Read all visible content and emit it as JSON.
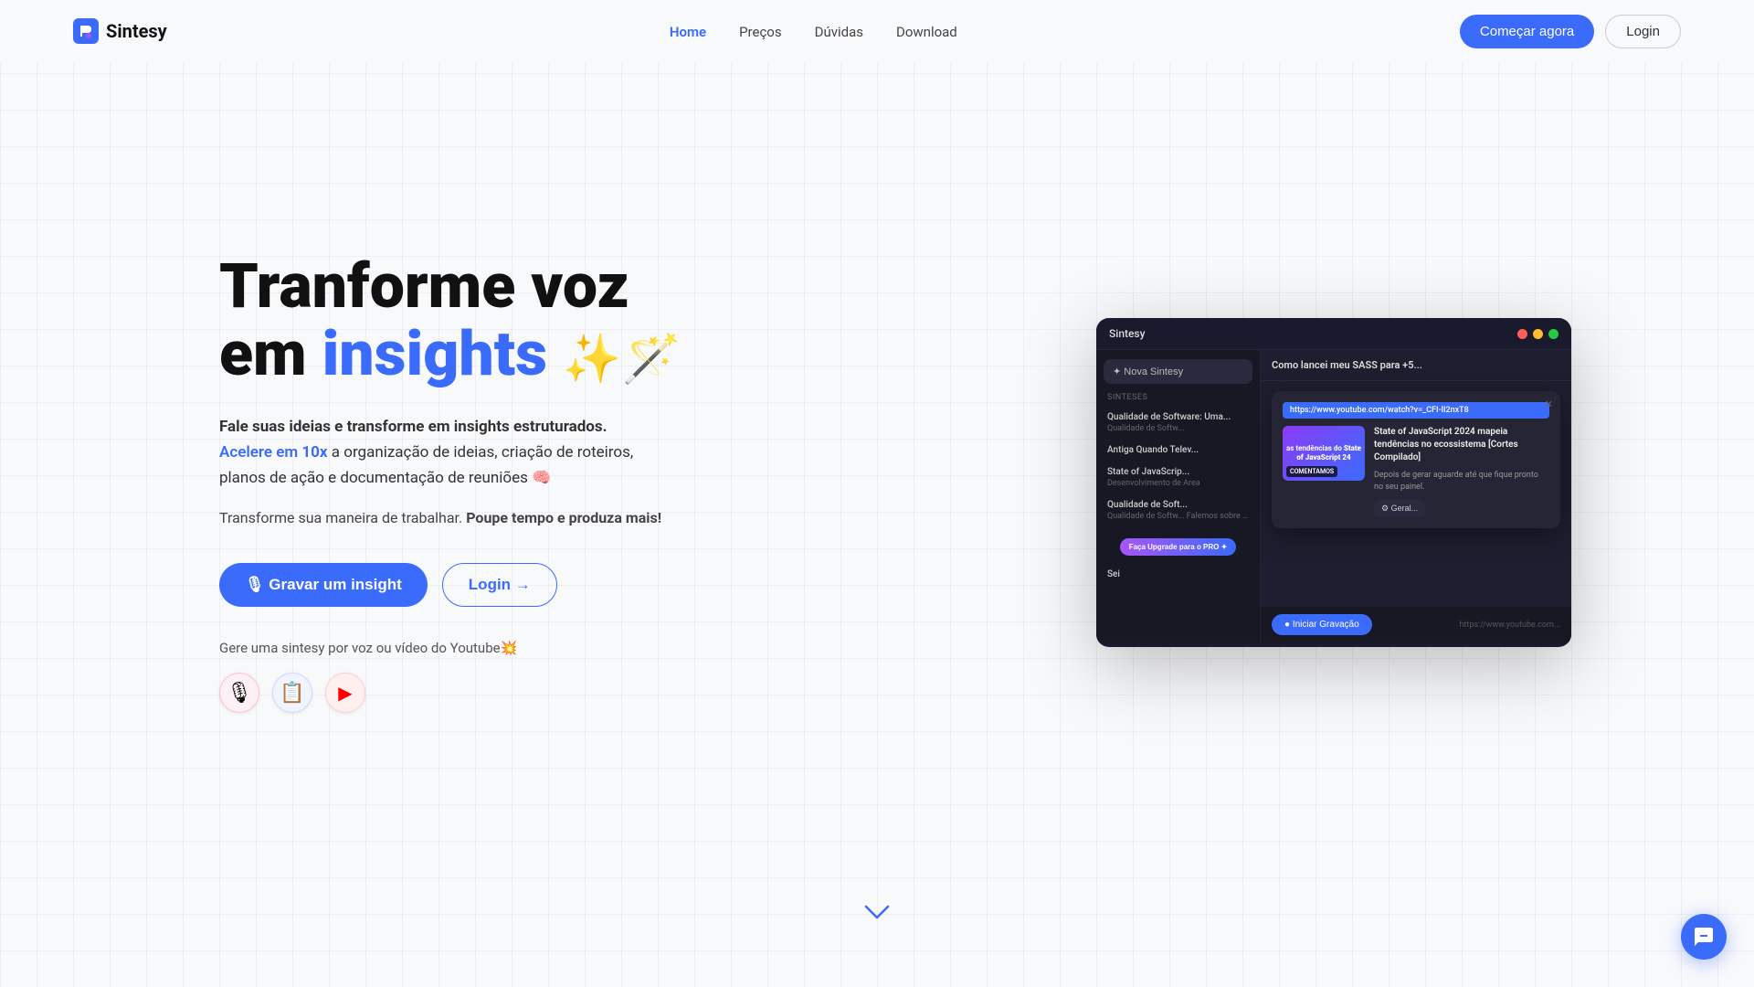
{
  "brand": {
    "name": "Sintesy",
    "logo_icon": "S"
  },
  "nav": {
    "links": [
      {
        "label": "Home",
        "active": true
      },
      {
        "label": "Preços",
        "active": false
      },
      {
        "label": "Dúvidas",
        "active": false
      },
      {
        "label": "Download",
        "active": false
      }
    ],
    "cta_primary": "Começar agora",
    "cta_login": "Login"
  },
  "hero": {
    "title_line1": "Tranforme voz",
    "title_line2_normal": "em ",
    "title_line2_accent": "insights",
    "title_emoji": "✨🪄",
    "subtitle1": "Fale suas ideias e transforme em insights estruturados.",
    "subtitle1_highlight": "Acelere em 10x",
    "subtitle1_rest": " a organização de ideias, criação de roteiros, planos de ação e documentação de reuniões 🧠",
    "tagline": "Transforme sua maneira de trabalhar.",
    "tagline_bold": "Poupe tempo e produza mais!",
    "btn_record": "🎙 Gravar um insight",
    "btn_login": "Login →",
    "generate_text": "Gere uma sintesy por voz ou vídeo do Youtube💥",
    "icons": [
      "🎙",
      "📋",
      "▶"
    ]
  },
  "app_preview": {
    "title": "Sintesy",
    "new_btn": "✦ Nova Sintesy",
    "section_label": "Sinteses",
    "sidebar_items": [
      {
        "title": "Qualidade de Software: Uma...",
        "sub": "Qualidade de Softw..."
      },
      {
        "title": "Antiga Quando Telev...",
        "sub": ""
      },
      {
        "title": "State of JavaScrip...",
        "sub": "Desenvolvimento de Area"
      },
      {
        "title": "Qualidade de Soft...",
        "sub": "Qualidade de Softw... Falemos sobre qual..."
      }
    ],
    "main_items": [
      {
        "title": "Como lancei meu SASS para +5...",
        "sub": ""
      }
    ],
    "popup": {
      "url": "https://www.youtube.com/watch?v=_CFI-lI2nxT8",
      "video_label": "COMENTAMOS",
      "video_text": "as tendências do State of JavaScript 24",
      "popup_title": "State of JavaScript 2024 mapeia tendências no ecossistema [Cortes Compilado]",
      "popup_desc": "Depois de gerar aguarde até que fique pronto no seu painel.",
      "generate_btn": "⚙ Geral..."
    },
    "record_btn": "● Iniciar Gravação",
    "yt_url": "https://www.youtube.com...",
    "upgrade_btn": "Faça Upgrade para o PRO ✦",
    "bottom_item": "Sei"
  },
  "scroll_indicator": "˅",
  "chat_bubble": "💬"
}
